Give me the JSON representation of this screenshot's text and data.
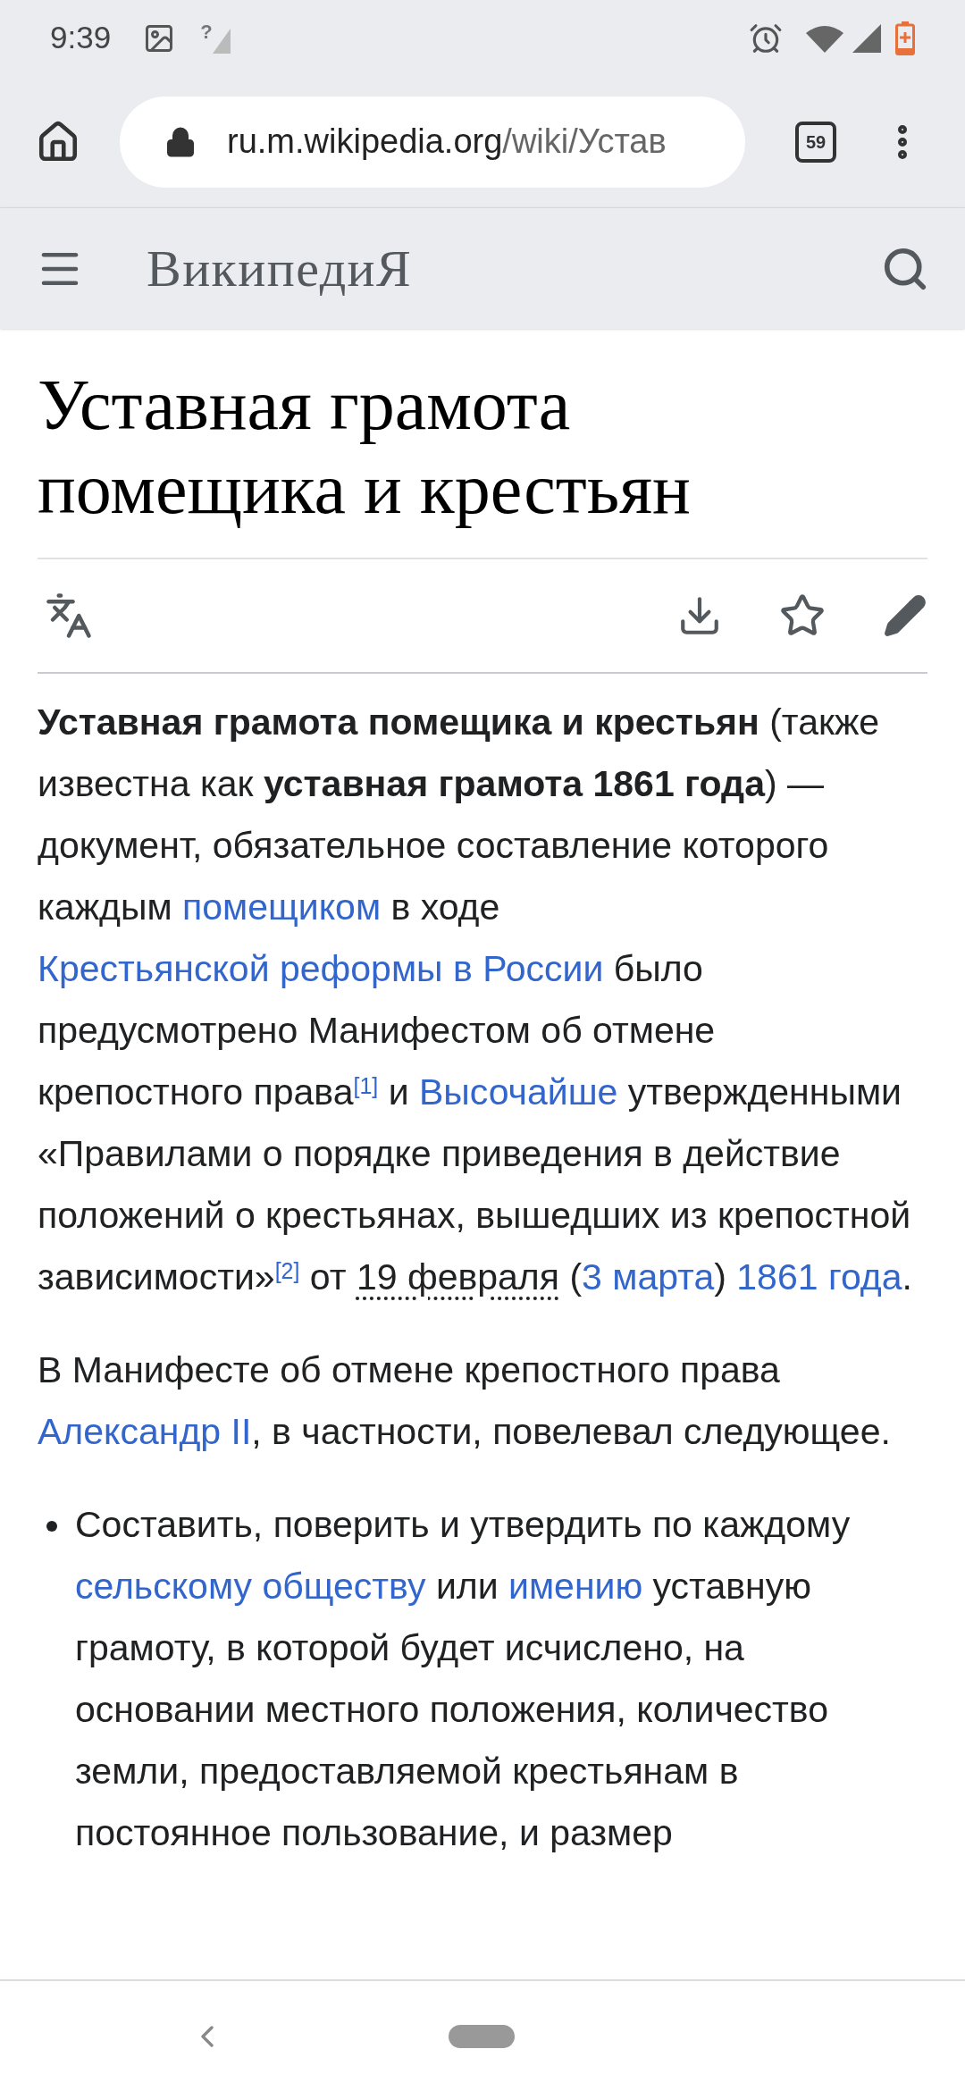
{
  "status_bar": {
    "time": "9:39",
    "signal_unknown": "?"
  },
  "browser": {
    "url_host": "ru.m.wikipedia.org",
    "url_path": "/wiki/Устав",
    "tab_count": "59"
  },
  "header": {
    "logo": "ВикипедиЯ"
  },
  "article": {
    "title": "Уставная грамота помещика и крестьян",
    "paragraphs": [
      {
        "kind": "paragraph",
        "segments": [
          {
            "kind": "bold",
            "text": "Уставная грамота помещика и крестьян"
          },
          {
            "kind": "text",
            "text": " (также известна как "
          },
          {
            "kind": "bold",
            "text": "уставная грамота 1861 года"
          },
          {
            "kind": "text",
            "text": ") — документ, обязательное составление которого каждым "
          },
          {
            "kind": "link",
            "text": "помещиком"
          },
          {
            "kind": "text",
            "text": " в ходе "
          },
          {
            "kind": "link",
            "text": "Крестьянской "
          },
          {
            "kind": "link",
            "text": "реформы в России"
          },
          {
            "kind": "text",
            "text": " было предусмотрено Манифестом об отмене крепостного права"
          },
          {
            "kind": "ref",
            "text": "[1]"
          },
          {
            "kind": "text",
            "text": " и "
          },
          {
            "kind": "link",
            "text": "Высочайше"
          },
          {
            "kind": "text",
            "text": " утвержденными «Правилами о порядке приведения в действие положений о крестьянах, вышедших из крепостной зависимости»"
          },
          {
            "kind": "ref",
            "text": "[2]"
          },
          {
            "kind": "text",
            "text": " от "
          },
          {
            "kind": "date",
            "text": "19 февраля"
          },
          {
            "kind": "text",
            "text": " ("
          },
          {
            "kind": "link",
            "text": "3 марта"
          },
          {
            "kind": "text",
            "text": ") "
          },
          {
            "kind": "link",
            "text": "1861 года"
          },
          {
            "kind": "text",
            "text": "."
          }
        ]
      },
      {
        "kind": "paragraph",
        "segments": [
          {
            "kind": "text",
            "text": "В Манифесте об отмене крепостного права "
          },
          {
            "kind": "link",
            "text": "Александр II"
          },
          {
            "kind": "text",
            "text": ", в частности, повелевал следующее."
          }
        ]
      },
      {
        "kind": "bullet",
        "segments": [
          {
            "kind": "text",
            "text": "Составить, поверить и утвердить по каждому "
          },
          {
            "kind": "link",
            "text": "сельскому обществу"
          },
          {
            "kind": "text",
            "text": " или "
          },
          {
            "kind": "link",
            "text": "имению"
          },
          {
            "kind": "text",
            "text": " уставную грамоту, в которой будет исчислено, на основании местного положения, количество земли, предоставляемой крестьянам в постоянное пользование, и размер"
          }
        ]
      }
    ]
  }
}
